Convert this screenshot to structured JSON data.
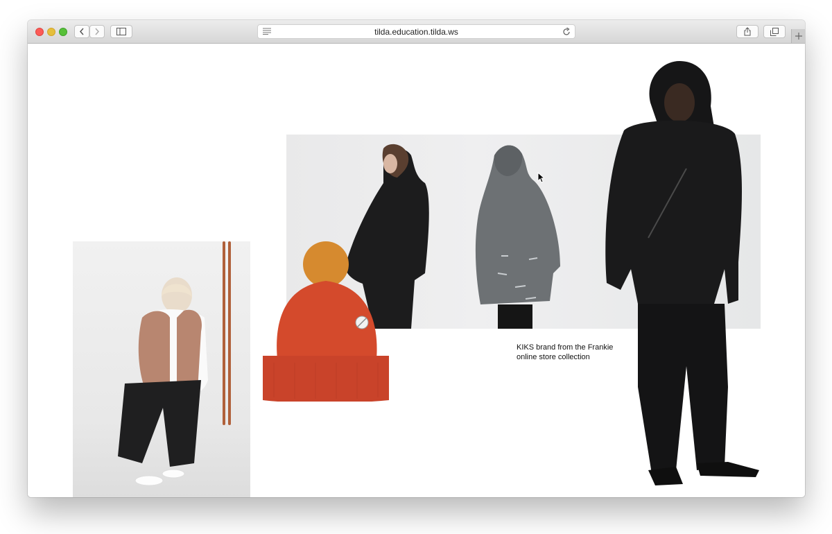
{
  "browser": {
    "url": "tilda.education.tilda.ws"
  },
  "page": {
    "caption": "KIKS brand from the Frankie online store collection"
  },
  "images": {
    "left_photo": "woman-in-fur-vest",
    "banner": "models-in-coats",
    "beanie": "red-pompom-beanie",
    "hooded_model": "man-in-black-hoodie"
  },
  "colors": {
    "beanie": "#d44a2c",
    "pompom": "#d68a2f",
    "coat_dark": "#1c1c1d",
    "coat_grey": "#6d7174"
  }
}
